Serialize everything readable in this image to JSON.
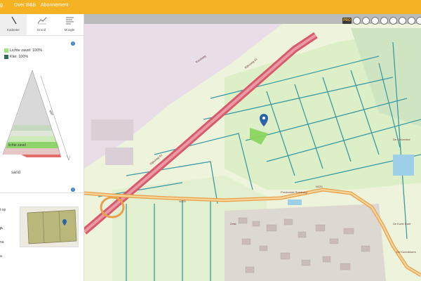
{
  "nav": {
    "items": [
      {
        "label": "ag"
      },
      {
        "label": "Over B&B"
      },
      {
        "label": "Abonnement"
      }
    ]
  },
  "tabs": [
    {
      "label": "Kadaster",
      "icon": "tree-icon"
    },
    {
      "label": "Grond",
      "icon": "chart-line-icon"
    },
    {
      "label": "Moogle",
      "icon": "list-icon"
    }
  ],
  "legend": {
    "items": [
      {
        "label": "Lichte zavel: 100%",
        "color": "#9de27b"
      },
      {
        "label": "Klei: 100%",
        "color": "#2f6b57"
      }
    ]
  },
  "soil_triangle": {
    "side_label": "klei",
    "bottom_label": "sand",
    "highlight_label": "lichte zavel"
  },
  "lower_fragments": {
    "op_text": "t op",
    "p_text": "p.",
    "na_text": "na",
    "a_text": "a"
  },
  "map": {
    "road_labels": [
      "Rijksweg A1",
      "Rijksweg A1",
      "Provinciale Rondweg",
      "N225",
      "N225",
      "Rondweg",
      "Zeist",
      "De Korte Kant",
      "De Korenbloem",
      "De Kerkenhof"
    ]
  },
  "toolbar": {
    "pro_label": "PRO",
    "buttons": [
      "layers-icon",
      "ruler-icon",
      "share-icon",
      "print-icon",
      "camera-icon",
      "location-icon",
      "zoom-out-icon",
      "zoom-in-icon"
    ]
  }
}
